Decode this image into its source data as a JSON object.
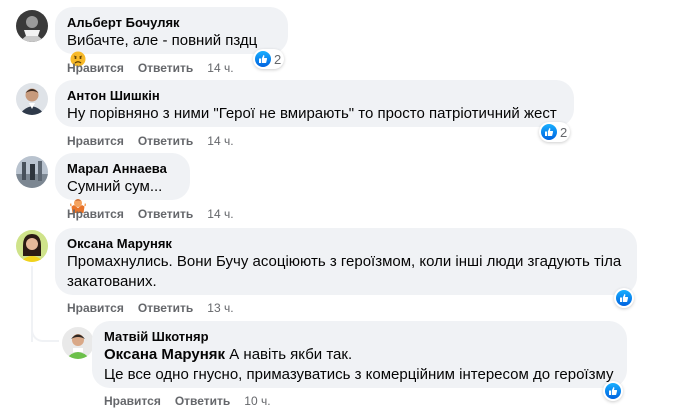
{
  "comments": [
    {
      "author": "Альберт Бочуляк",
      "text": "Вибачте, але - повний пздц",
      "emoji": "sad-face",
      "like_label": "Нравится",
      "reply_label": "Ответить",
      "time": "14 ч.",
      "reactions": "2"
    },
    {
      "author": "Антон Шишкін",
      "text": "Ну порівняно з ними \"Герої не вмирають\" то просто патріотичний жест",
      "like_label": "Нравится",
      "reply_label": "Ответить",
      "time": "14 ч.",
      "reactions": "2"
    },
    {
      "author": "Марал Аннаева",
      "text": "Сумний сум...",
      "emoji": "shrug-person",
      "like_label": "Нравится",
      "reply_label": "Ответить",
      "time": "14 ч."
    },
    {
      "author": "Оксана Маруняк",
      "text_line1": "Промахнулись. Вони Бучу асоціюють з героїзмом, коли інші люди згадують тіла",
      "text_line2": "закатованих.",
      "like_label": "Нравится",
      "reply_label": "Ответить",
      "time": "13 ч."
    },
    {
      "author": "Матвій Шкотняр",
      "mention": "Оксана Маруняк",
      "text_line1": "А навіть якби так.",
      "text_line2": "Це все одно гнусно, примазуватись з комерційним інтересом до героїзму",
      "like_label": "Нравится",
      "reply_label": "Ответить",
      "time": "10 ч."
    }
  ],
  "colors": {
    "bubble": "#f0f2f5",
    "meta": "#65676b",
    "like_blue": "#1877f2"
  }
}
